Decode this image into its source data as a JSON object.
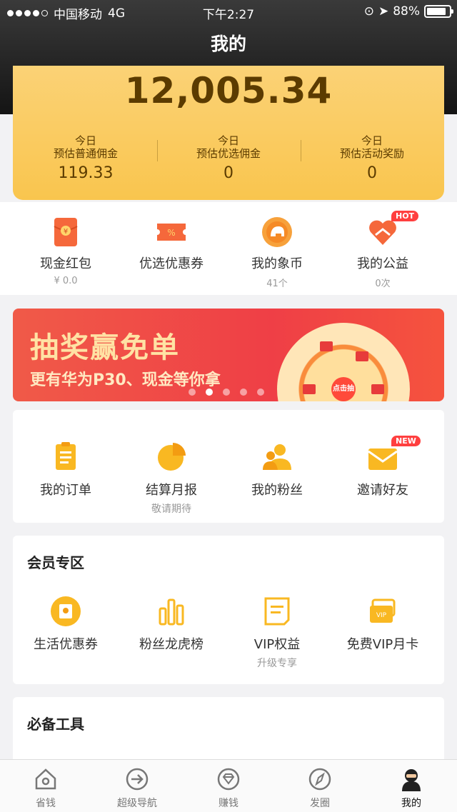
{
  "status_bar": {
    "carrier": "中国移动",
    "network": "4G",
    "time": "下午2:27",
    "battery": "88%"
  },
  "header": {
    "title": "我的"
  },
  "earnings": {
    "total": "12,005.34",
    "cols": [
      {
        "line1": "今日",
        "line2": "预估普通佣金",
        "value": "119.33"
      },
      {
        "line1": "今日",
        "line2": "预估优选佣金",
        "value": "0"
      },
      {
        "line1": "今日",
        "line2": "预估活动奖励",
        "value": "0"
      }
    ]
  },
  "quick": [
    {
      "label": "现金红包",
      "sub": "¥ 0.0",
      "icon": "red-envelope-icon"
    },
    {
      "label": "优选优惠券",
      "sub": "",
      "icon": "coupon-icon"
    },
    {
      "label": "我的象币",
      "sub": "41个",
      "icon": "elephant-coin-icon"
    },
    {
      "label": "我的公益",
      "sub": "0次",
      "icon": "heart-hand-icon",
      "badge": "HOT"
    }
  ],
  "banner": {
    "title": "抽奖赢免单",
    "subtitle": "更有华为P30、现金等你拿",
    "wheel_center": "点击抽奖",
    "pages": 5,
    "active_page": 2
  },
  "orders": [
    {
      "label": "我的订单",
      "sub": "",
      "icon": "order-list-icon"
    },
    {
      "label": "结算月报",
      "sub": "敬请期待",
      "icon": "pie-chart-icon"
    },
    {
      "label": "我的粉丝",
      "sub": "",
      "icon": "fans-icon"
    },
    {
      "label": "邀请好友",
      "sub": "",
      "icon": "invite-envelope-icon",
      "badge": "NEW"
    }
  ],
  "member": {
    "title": "会员专区",
    "items": [
      {
        "label": "生活优惠券",
        "sub": "",
        "icon": "life-coupon-icon"
      },
      {
        "label": "粉丝龙虎榜",
        "sub": "",
        "icon": "bar-rank-icon"
      },
      {
        "label": "VIP权益",
        "sub": "升级专享",
        "icon": "vip-doc-icon"
      },
      {
        "label": "免费VIP月卡",
        "sub": "",
        "icon": "vip-card-icon"
      }
    ]
  },
  "tools": {
    "title": "必备工具"
  },
  "tabbar": [
    {
      "label": "省钱",
      "icon": "home-icon"
    },
    {
      "label": "超级导航",
      "icon": "arrow-circle-icon"
    },
    {
      "label": "赚钱",
      "icon": "diamond-icon"
    },
    {
      "label": "发圈",
      "icon": "compass-icon"
    },
    {
      "label": "我的",
      "icon": "avatar-icon",
      "active": true
    }
  ],
  "colors": {
    "accent": "#f9c54e",
    "banner": "#ef3f46",
    "badge": "#ff3f3f"
  }
}
